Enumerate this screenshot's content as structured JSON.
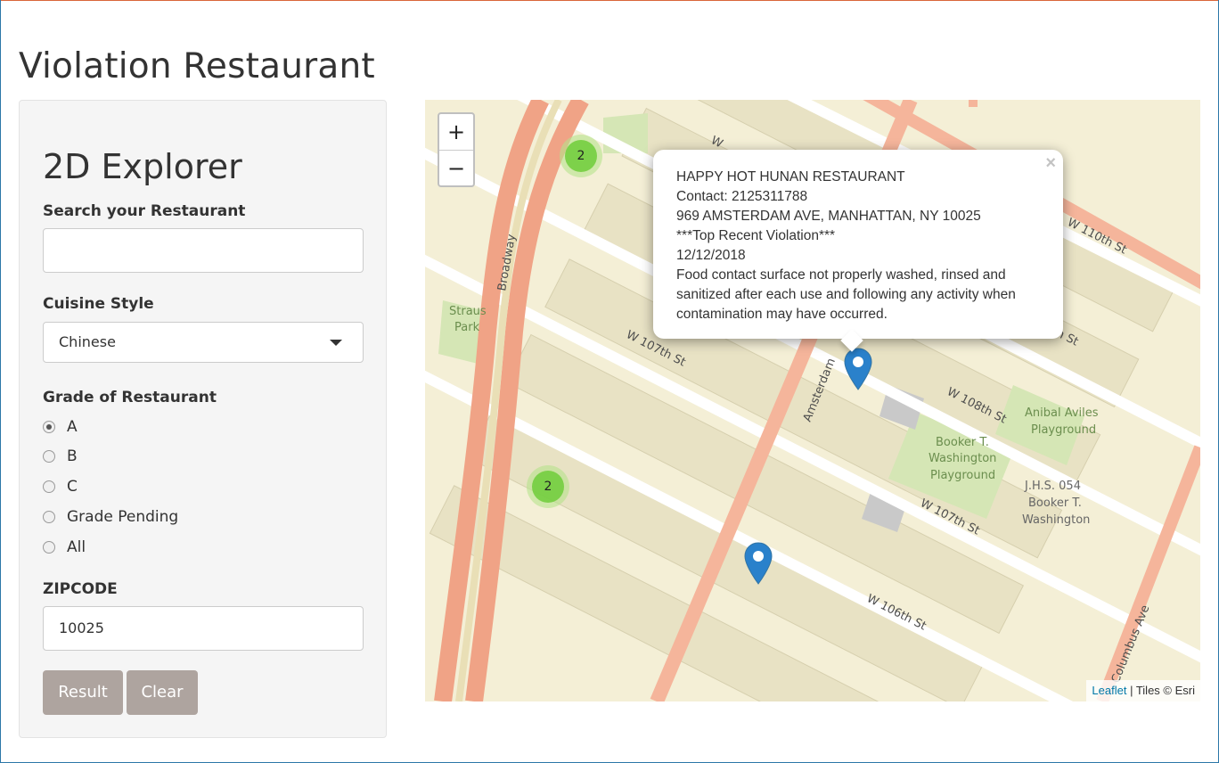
{
  "app": {
    "title": "Violation Restaurant"
  },
  "sidebar": {
    "title": "2D Explorer",
    "search": {
      "label": "Search your Restaurant",
      "value": ""
    },
    "cuisine": {
      "label": "Cuisine Style",
      "selected": "Chinese"
    },
    "grade": {
      "label": "Grade of Restaurant",
      "options": [
        "A",
        "B",
        "C",
        "Grade Pending",
        "All"
      ],
      "selected": "A"
    },
    "zipcode": {
      "label": "ZIPCODE",
      "value": "10025"
    },
    "buttons": {
      "result": "Result",
      "clear": "Clear"
    }
  },
  "map": {
    "zoom_in": "+",
    "zoom_out": "−",
    "clusters": [
      {
        "count": "2"
      },
      {
        "count": "2"
      }
    ],
    "popup": {
      "close": "×",
      "name": "HAPPY HOT HUNAN RESTAURANT",
      "contact": "Contact: 2125311788",
      "address": "969 AMSTERDAM AVE, MANHATTAN, NY 10025",
      "violation_header": "***Top Recent Violation***",
      "date": "12/12/2018",
      "description_lines": [
        "Food contact surface not properly washed, rinsed and",
        "sanitized after each use and following any activity when",
        "contamination may have occurred."
      ]
    },
    "street_labels": {
      "broadway": "Broadway",
      "w107_upper": "W 107th St",
      "w108": "W 108th St",
      "w110": "W 110th St",
      "w107_lower": "W 107th St",
      "w106": "W 106th St",
      "amsterdam": "Amsterdam",
      "columbus": "Columbus Ave",
      "w_top": "W",
      "th_st": "th St"
    },
    "park_labels": {
      "straus_1": "Straus",
      "straus_2": "Park",
      "aviles_1": "Anibal Aviles",
      "aviles_2": "Playground",
      "booker_1": "Booker T.",
      "booker_2": "Washington",
      "booker_3": "Playground",
      "jhs_1": "J.H.S. 054",
      "jhs_2": "Booker T.",
      "jhs_3": "Washington"
    },
    "attribution": {
      "leaflet": "Leaflet",
      "tiles": " | Tiles © Esri"
    },
    "colors": {
      "background": "#f4efd6",
      "arterial": "#f0a386",
      "park": "#d5e6b5",
      "marker": "#2a81cb",
      "cluster": "#6ecc39"
    }
  }
}
